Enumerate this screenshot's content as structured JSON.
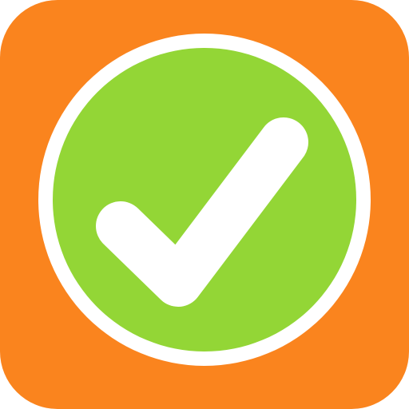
{
  "icon": {
    "name": "checkmark-app-icon",
    "background_color": "#FA841E",
    "ring_color": "#FFFFFF",
    "circle_color": "#93D636",
    "check_color": "#FFFFFF",
    "glyph": "check-icon"
  }
}
